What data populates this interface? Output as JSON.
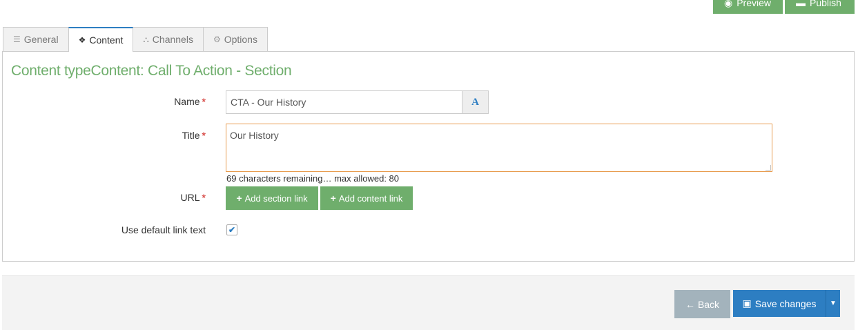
{
  "toolbar": {
    "preview_label": "Preview",
    "publish_label": "Publish"
  },
  "tabs": [
    {
      "label": "General",
      "icon": "sliders-icon"
    },
    {
      "label": "Content",
      "icon": "cubes-icon",
      "active": true
    },
    {
      "label": "Channels",
      "icon": "sitemap-icon"
    },
    {
      "label": "Options",
      "icon": "gears-icon"
    }
  ],
  "panel": {
    "title": "Content typeContent: Call To Action - Section"
  },
  "form": {
    "name_label": "Name",
    "name_value": "CTA - Our History",
    "title_label": "Title",
    "title_value": "Our History",
    "char_note": "69 characters remaining… max allowed: 80",
    "url_label": "URL",
    "add_section_link": "Add section link",
    "add_content_link": "Add content link",
    "default_link_label": "Use default link text",
    "default_link_checked": true,
    "required_mark": "*"
  },
  "footer": {
    "back_label": "Back",
    "save_label": "Save changes"
  },
  "colors": {
    "accent_green": "#6fae6c",
    "primary_blue": "#2d7ec2",
    "required_red": "#d9534f",
    "focus_orange": "#e89b4d"
  }
}
